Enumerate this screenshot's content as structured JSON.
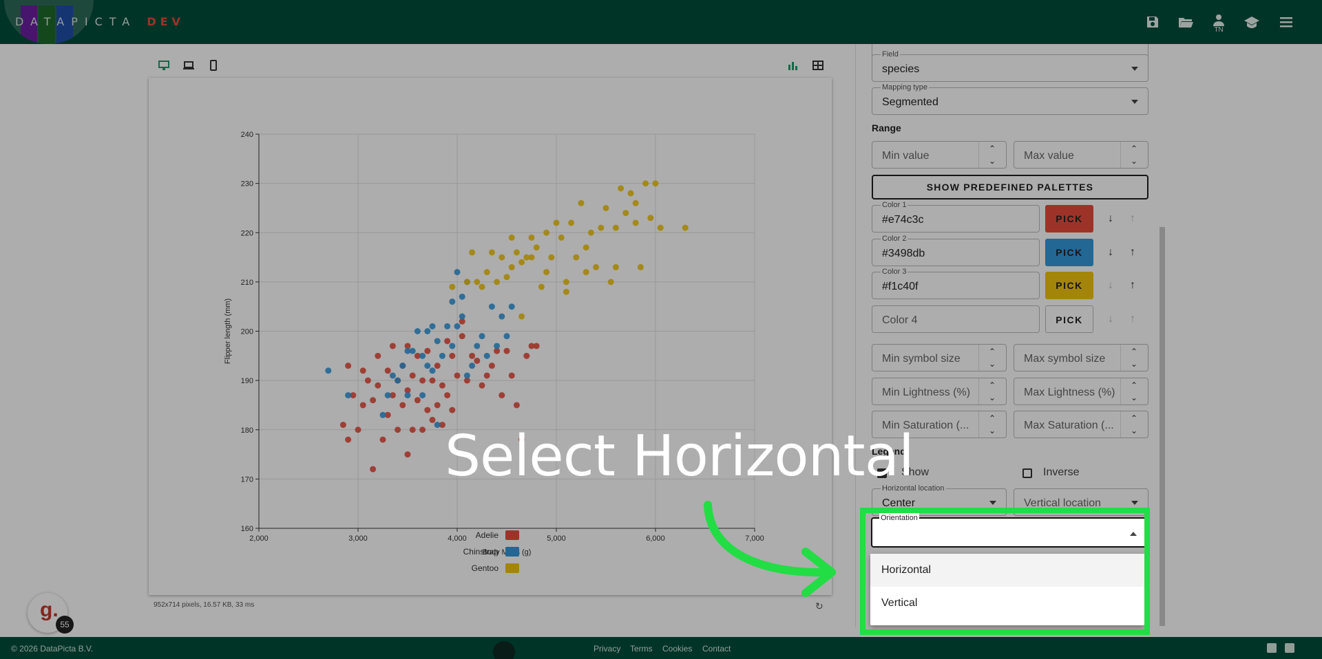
{
  "app": {
    "logo_text": "DATAPICTA",
    "logo_suffix": "DEV",
    "user_initials": "TN",
    "logo_colors": [
      "#6a1fa0",
      "#1e6a2a",
      "#1f4fa8"
    ]
  },
  "toolbar": {
    "icons": [
      "save-icon",
      "folder-open-icon",
      "user-icon",
      "graduation-cap-icon",
      "menu-icon"
    ],
    "device_icons": [
      "desktop-icon",
      "laptop-icon",
      "phone-icon"
    ],
    "view_icons": [
      "bar-chart-icon",
      "table-icon"
    ]
  },
  "chart_status": "952x714 pixels, 16.57 KB, 33 ms",
  "chart_data": {
    "type": "scatter",
    "xlabel": "Body Mass (g)",
    "ylabel": "Flipper length (mm)",
    "xlim": [
      2000,
      7000
    ],
    "ylim": [
      160,
      240
    ],
    "xticks": [
      "2,000",
      "3,000",
      "4,000",
      "5,000",
      "6,000",
      "7,000"
    ],
    "yticks": [
      "160",
      "170",
      "180",
      "190",
      "200",
      "210",
      "220",
      "230",
      "240"
    ],
    "grid": true,
    "legend_placement": "bottom-center",
    "series": [
      {
        "name": "Adelie",
        "color": "#e74c3c",
        "points": [
          [
            2850,
            181
          ],
          [
            2900,
            178
          ],
          [
            2900,
            193
          ],
          [
            2950,
            187
          ],
          [
            3000,
            180
          ],
          [
            3050,
            192
          ],
          [
            3050,
            185
          ],
          [
            3100,
            190
          ],
          [
            3150,
            186
          ],
          [
            3150,
            172
          ],
          [
            3200,
            189
          ],
          [
            3200,
            195
          ],
          [
            3250,
            178
          ],
          [
            3300,
            192
          ],
          [
            3300,
            183
          ],
          [
            3350,
            187
          ],
          [
            3350,
            197
          ],
          [
            3400,
            180
          ],
          [
            3400,
            190
          ],
          [
            3450,
            193
          ],
          [
            3450,
            185
          ],
          [
            3500,
            175
          ],
          [
            3500,
            188
          ],
          [
            3500,
            197
          ],
          [
            3550,
            191
          ],
          [
            3550,
            180
          ],
          [
            3600,
            186
          ],
          [
            3600,
            195
          ],
          [
            3650,
            180
          ],
          [
            3650,
            190
          ],
          [
            3700,
            196
          ],
          [
            3700,
            184
          ],
          [
            3750,
            182
          ],
          [
            3750,
            190
          ],
          [
            3800,
            185
          ],
          [
            3800,
            193
          ],
          [
            3850,
            189
          ],
          [
            3850,
            181
          ],
          [
            3900,
            198
          ],
          [
            3900,
            187
          ],
          [
            3950,
            184
          ],
          [
            3950,
            195
          ],
          [
            4000,
            191
          ],
          [
            4050,
            199
          ],
          [
            4050,
            202
          ],
          [
            4100,
            190
          ],
          [
            4150,
            195
          ],
          [
            4200,
            194
          ],
          [
            4250,
            189
          ],
          [
            4300,
            191
          ],
          [
            4350,
            193
          ],
          [
            4400,
            196
          ],
          [
            4450,
            187
          ],
          [
            4500,
            196
          ],
          [
            4550,
            191
          ],
          [
            4600,
            185
          ],
          [
            4650,
            178
          ],
          [
            4700,
            195
          ],
          [
            4750,
            197
          ],
          [
            4800,
            197
          ]
        ]
      },
      {
        "name": "Chinstrap",
        "color": "#3498db",
        "points": [
          [
            2700,
            192
          ],
          [
            2900,
            187
          ],
          [
            3250,
            183
          ],
          [
            3300,
            187
          ],
          [
            3350,
            191
          ],
          [
            3400,
            190
          ],
          [
            3450,
            193
          ],
          [
            3500,
            196
          ],
          [
            3500,
            187
          ],
          [
            3550,
            196
          ],
          [
            3600,
            200
          ],
          [
            3650,
            195
          ],
          [
            3650,
            187
          ],
          [
            3700,
            193
          ],
          [
            3700,
            200
          ],
          [
            3750,
            192
          ],
          [
            3750,
            201
          ],
          [
            3800,
            198
          ],
          [
            3800,
            181
          ],
          [
            3850,
            195
          ],
          [
            3900,
            201
          ],
          [
            3950,
            197
          ],
          [
            4000,
            201
          ],
          [
            4050,
            203
          ],
          [
            4100,
            191
          ],
          [
            4150,
            193
          ],
          [
            4200,
            197
          ],
          [
            4250,
            199
          ],
          [
            4300,
            195
          ],
          [
            4350,
            205
          ],
          [
            4400,
            197
          ],
          [
            4450,
            203
          ],
          [
            4500,
            199
          ],
          [
            4550,
            205
          ],
          [
            4000,
            212
          ],
          [
            4050,
            207
          ],
          [
            4100,
            210
          ],
          [
            3950,
            206
          ]
        ]
      },
      {
        "name": "Gentoo",
        "color": "#f1c40f",
        "points": [
          [
            3950,
            209
          ],
          [
            4100,
            210
          ],
          [
            4150,
            216
          ],
          [
            4200,
            210
          ],
          [
            4250,
            209
          ],
          [
            4300,
            212
          ],
          [
            4350,
            216
          ],
          [
            4400,
            210
          ],
          [
            4450,
            215
          ],
          [
            4500,
            211
          ],
          [
            4550,
            213
          ],
          [
            4600,
            216
          ],
          [
            4650,
            214
          ],
          [
            4700,
            215
          ],
          [
            4750,
            219
          ],
          [
            4800,
            217
          ],
          [
            4850,
            209
          ],
          [
            4900,
            220
          ],
          [
            4950,
            215
          ],
          [
            5000,
            222
          ],
          [
            5050,
            219
          ],
          [
            5100,
            210
          ],
          [
            5150,
            222
          ],
          [
            5200,
            215
          ],
          [
            5250,
            226
          ],
          [
            5300,
            217
          ],
          [
            5350,
            220
          ],
          [
            5400,
            213
          ],
          [
            5450,
            221
          ],
          [
            5500,
            225
          ],
          [
            5550,
            210
          ],
          [
            5600,
            221
          ],
          [
            5650,
            229
          ],
          [
            5700,
            224
          ],
          [
            5750,
            228
          ],
          [
            5800,
            222
          ],
          [
            5850,
            213
          ],
          [
            5900,
            230
          ],
          [
            5950,
            223
          ],
          [
            6000,
            230
          ],
          [
            6050,
            221
          ],
          [
            6300,
            221
          ],
          [
            4650,
            203
          ],
          [
            4750,
            215
          ],
          [
            4900,
            212
          ],
          [
            5100,
            208
          ],
          [
            5300,
            212
          ],
          [
            5600,
            213
          ],
          [
            5800,
            226
          ],
          [
            4550,
            219
          ]
        ]
      }
    ]
  },
  "panel": {
    "field_label": "Field",
    "field_value": "species",
    "mapping_label": "Mapping type",
    "mapping_value": "Segmented",
    "range_heading": "Range",
    "min_value_placeholder": "Min value",
    "max_value_placeholder": "Max value",
    "palettes_button": "SHOW PREDEFINED PALETTES",
    "colors": [
      {
        "label": "Color 1",
        "value": "#e74c3c",
        "pick": "PICK",
        "swatch": "#e74c3c"
      },
      {
        "label": "Color 2",
        "value": "#3498db",
        "pick": "PICK",
        "swatch": "#3498db"
      },
      {
        "label": "Color 3",
        "value": "#f1c40f",
        "pick": "PICK",
        "swatch": "#f1c40f"
      },
      {
        "label": "Color 4",
        "value": "",
        "pick": "PICK",
        "swatch": "#ffffff"
      }
    ],
    "min_symbol_size": "Min symbol size",
    "max_symbol_size": "Max symbol size",
    "min_lightness": "Min Lightness (%)",
    "max_lightness": "Max Lightness (%)",
    "min_saturation": "Min Saturation (...",
    "max_saturation": "Max Saturation (...",
    "legend_heading": "Legend",
    "show_label": "Show",
    "inverse_label": "Inverse",
    "horizontal_location_label": "Horizontal location",
    "horizontal_location_value": "Center",
    "vertical_location_placeholder": "Vertical location",
    "orientation_label": "Orientation",
    "orientation_options": [
      "Horizontal",
      "Vertical"
    ]
  },
  "tutorial": {
    "instruction": "Select Horizontal"
  },
  "footer": {
    "copyright": "© 2026 DataPicta B.V.",
    "links": [
      "Privacy",
      "Terms",
      "Cookies",
      "Contact"
    ],
    "social_icons": [
      "youtube-icon",
      "linkedin-icon"
    ]
  },
  "badge": {
    "letter": "g.",
    "count": "55"
  }
}
